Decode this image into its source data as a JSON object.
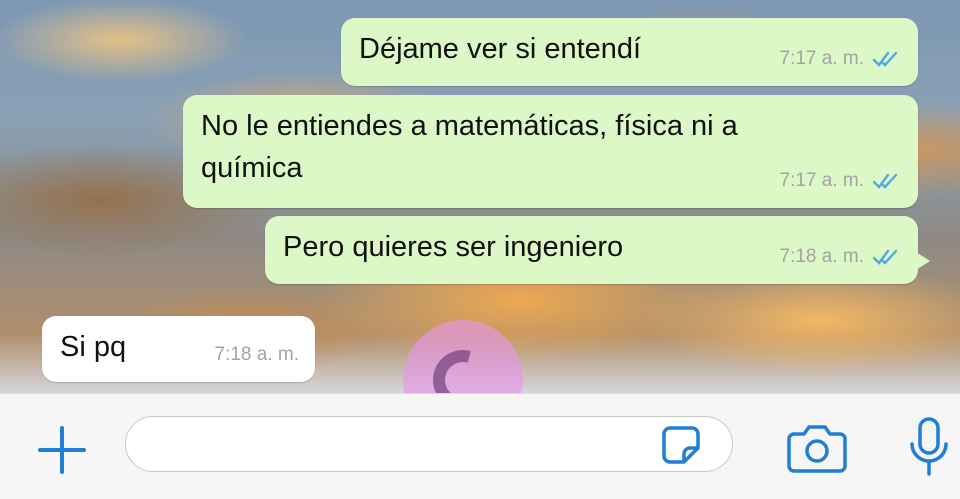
{
  "messages": [
    {
      "text": "Déjame ver si entendí",
      "time": "7:17 a. m.",
      "direction": "outgoing",
      "status_icon": "double-check-read-icon"
    },
    {
      "text_line1": "No le entiendes a matemáticas, física ni a",
      "text_line2": "química",
      "time": "7:17 a. m.",
      "direction": "outgoing",
      "status_icon": "double-check-read-icon"
    },
    {
      "text": "Pero quieres ser ingeniero",
      "time": "7:18 a. m.",
      "direction": "outgoing",
      "status_icon": "double-check-read-icon"
    },
    {
      "text": "Si pq",
      "time": "7:18 a. m.",
      "direction": "incoming"
    }
  ],
  "input_bar": {
    "message_value": "",
    "icons": [
      "plus-icon",
      "sticker-icon",
      "camera-icon",
      "microphone-icon"
    ]
  },
  "colors": {
    "outgoing_bubble": "#dcf8c6",
    "incoming_bubble": "#ffffff",
    "accent": "#1f7fd6",
    "read_tick": "#4fa8e8",
    "timestamp": "#a3a3a3"
  }
}
